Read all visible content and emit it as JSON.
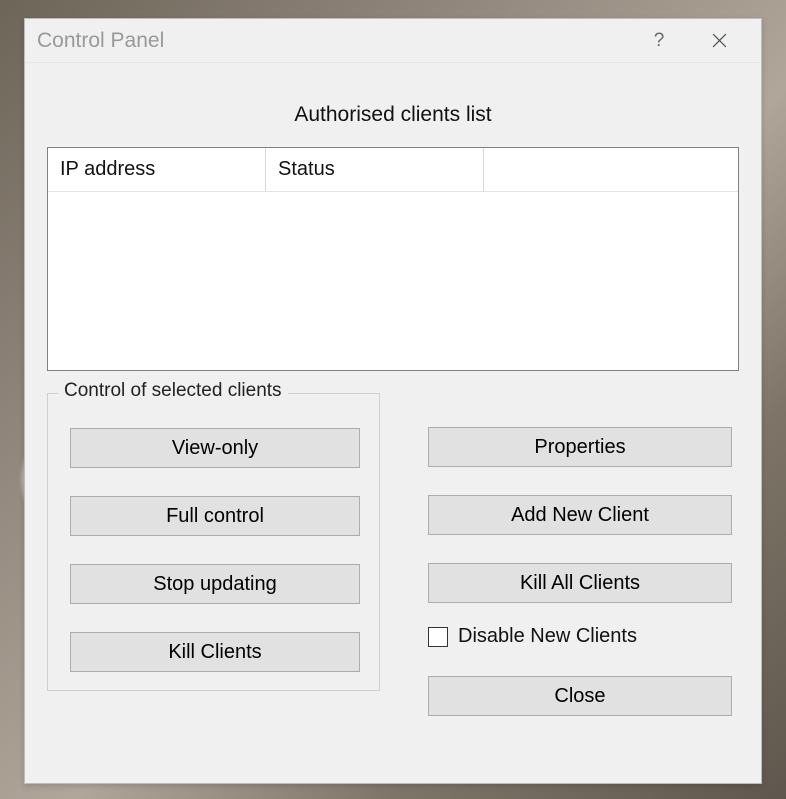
{
  "title": "Control Panel",
  "sectionTitle": "Authorised clients list",
  "columns": {
    "ip": "IP address",
    "status": "Status"
  },
  "group": {
    "legend": "Control of selected clients",
    "viewOnly": "View-only",
    "fullControl": "Full control",
    "stopUpdating": "Stop updating",
    "killClients": "Kill Clients"
  },
  "right": {
    "properties": "Properties",
    "addNew": "Add New Client",
    "killAll": "Kill All Clients",
    "disableNew": "Disable New Clients",
    "close": "Close"
  }
}
